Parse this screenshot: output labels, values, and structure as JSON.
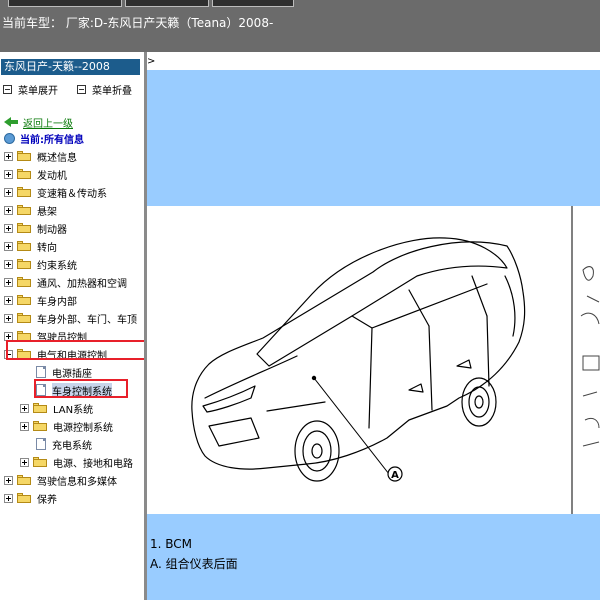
{
  "header": {
    "vehicle_label": "当前车型：  厂家:D-东风日产天籁（Teana）2008-"
  },
  "sidebar": {
    "title": "东风日产-天籁--2008",
    "expand_menu": "菜单展开",
    "collapse_menu": "菜单折叠",
    "back_label": "返回上一级",
    "current_label": "当前:所有信息",
    "items": [
      {
        "label": "概述信息"
      },
      {
        "label": "发动机"
      },
      {
        "label": "变速箱＆传动系"
      },
      {
        "label": "悬架"
      },
      {
        "label": "制动器"
      },
      {
        "label": "转向"
      },
      {
        "label": "约束系统"
      },
      {
        "label": "通风、加热器和空调"
      },
      {
        "label": "车身内部"
      },
      {
        "label": "车身外部、车门、车顶"
      },
      {
        "label": "驾驶员控制"
      },
      {
        "label": "电气和电源控制"
      },
      {
        "label": "电源插座"
      },
      {
        "label": "车身控制系统"
      },
      {
        "label": "LAN系统"
      },
      {
        "label": "电源控制系统"
      },
      {
        "label": "充电系统"
      },
      {
        "label": "电源、接地和电路"
      },
      {
        "label": "驾驶信息和多媒体"
      },
      {
        "label": "保养"
      }
    ]
  },
  "content": {
    "breadcrumb_marker": ">",
    "callout_label": "A",
    "notes": [
      "1. BCM",
      "A. 组合仪表后面"
    ]
  },
  "colors": {
    "highlight_box": "#e8202a",
    "sidebar_title_bg": "#1c5c8c",
    "content_band": "#99ccff",
    "top_bar": "#6b6b6b"
  }
}
